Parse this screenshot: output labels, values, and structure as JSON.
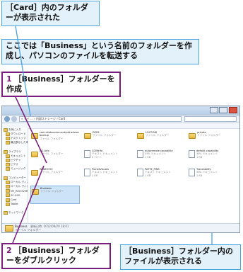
{
  "callouts": {
    "top": "［Card］内のフォルダーが表示された",
    "middle": "ここでは「Business」という名前のフォルダーを作成し、パソコンのファイルを転送する",
    "bottom_right": "［Business］フォルダー内のファイルが表示される"
  },
  "steps": [
    {
      "num": "1",
      "text": "［Business］フォルダーを作成"
    },
    {
      "num": "2",
      "text": "［Business］フォルダーをダブルクリック"
    }
  ],
  "explorer": {
    "address": "« マイ ... › 内部ストレージ › Card",
    "nav_items": [
      {
        "label": "お気に入り",
        "indent": false
      },
      {
        "label": "ダウンロード",
        "indent": true
      },
      {
        "label": "デスクトップ",
        "indent": true
      },
      {
        "label": "最近表示した場所",
        "indent": true
      },
      {
        "label": "",
        "indent": false
      },
      {
        "label": "ライブラリ",
        "indent": false
      },
      {
        "label": "ドキュメント",
        "indent": true
      },
      {
        "label": "ピクチャ",
        "indent": true
      },
      {
        "label": "ビデオ",
        "indent": true
      },
      {
        "label": "ミュージック",
        "indent": true
      },
      {
        "label": "",
        "indent": false
      },
      {
        "label": "コンピューター",
        "indent": false
      },
      {
        "label": "ローカル ディスク (C:)",
        "indent": true
      },
      {
        "label": "ローカル ディスク (D:)",
        "indent": true
      },
      {
        "label": "MY_RECOVERY (F:)",
        "indent": true
      },
      {
        "label": "SC-05G",
        "indent": true
      },
      {
        "label": "Card",
        "indent": true
      },
      {
        "label": "Tablet",
        "indent": true
      },
      {
        "label": "",
        "indent": false
      },
      {
        "label": "ネットワーク",
        "indent": false
      }
    ],
    "files": [
      {
        "name": "com.nttdocomo.android.advanced backup",
        "type": "ファイル フォルダー",
        "kind": "folder"
      },
      {
        "name": "DCIM",
        "type": "ファイル フォルダー",
        "kind": "folder"
      },
      {
        "name": "LOST.DIR",
        "type": "ファイル フォルダー",
        "kind": "folder"
      },
      {
        "name": "private",
        "type": "ファイル フォルダー",
        "kind": "folder"
      },
      {
        "name": "DS_Info",
        "type": "ファイル フォルダー",
        "kind": "folder"
      },
      {
        "name": "COMinfo",
        "type": "テキスト ドキュメント",
        "size": "0 バイト",
        "kind": "doc"
      },
      {
        "name": "autoremote capability",
        "type": "XML ドキュメント",
        "size": "1 KB",
        "kind": "doc"
      },
      {
        "name": "default capability",
        "type": "XML ドキュメント",
        "size": "1 KB",
        "kind": "doc"
      },
      {
        "name": "WIN6972E",
        "type": "ファイル フォルダー",
        "kind": "folder"
      },
      {
        "name": "PlanetVisuals",
        "type": "テキスト ドキュメント",
        "size": "1 KB",
        "kind": "doc"
      },
      {
        "name": "PATTE_PINS",
        "type": "テキスト ドキュメント",
        "size": "1 KB",
        "kind": "doc"
      },
      {
        "name": "Traceability",
        "type": "XML ドキュメント",
        "size": "1 KB",
        "kind": "doc"
      },
      {
        "name": "Business",
        "type": "ファイル フォルダー",
        "kind": "folder",
        "selected": true
      }
    ],
    "status": {
      "name": "Business",
      "info": "更新日時: 2012/09/20 18:01",
      "type": "ファイル フォルダー"
    }
  }
}
